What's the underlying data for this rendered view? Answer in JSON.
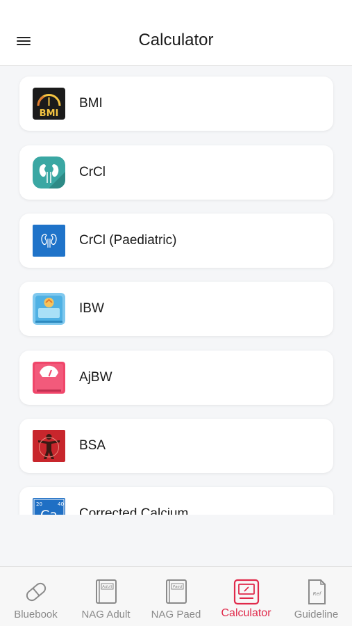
{
  "header": {
    "title": "Calculator",
    "menu_icon": "hamburger-menu-icon"
  },
  "calculators": [
    {
      "label": "BMI",
      "icon": "bmi-gauge-icon",
      "icon_text": "BMI"
    },
    {
      "label": "CrCl",
      "icon": "kidney-icon"
    },
    {
      "label": "CrCl (Paediatric)",
      "icon": "kidney-blue-icon"
    },
    {
      "label": "IBW",
      "icon": "ideal-body-weight-icon"
    },
    {
      "label": "AjBW",
      "icon": "weighing-scale-icon"
    },
    {
      "label": "BSA",
      "icon": "body-surface-area-icon"
    },
    {
      "label": "Corrected Calcium",
      "icon": "calcium-element-icon",
      "icon_text": "Ca",
      "icon_number_left": "20",
      "icon_number_right": "40"
    }
  ],
  "tabs": [
    {
      "label": "Bluebook",
      "icon": "pill-icon",
      "active": false
    },
    {
      "label": "NAG Adult",
      "icon": "adult-book-icon",
      "icon_text": "Adult",
      "active": false
    },
    {
      "label": "NAG Paed",
      "icon": "paed-book-icon",
      "icon_text": "Paed",
      "active": false
    },
    {
      "label": "Calculator",
      "icon": "calculator-tab-icon",
      "active": true
    },
    {
      "label": "Guideline",
      "icon": "reference-document-icon",
      "icon_text": "Ref",
      "active": false
    }
  ],
  "colors": {
    "accent": "#e0294a",
    "tab_inactive": "#8a8a8a",
    "background": "#f5f6f8"
  }
}
